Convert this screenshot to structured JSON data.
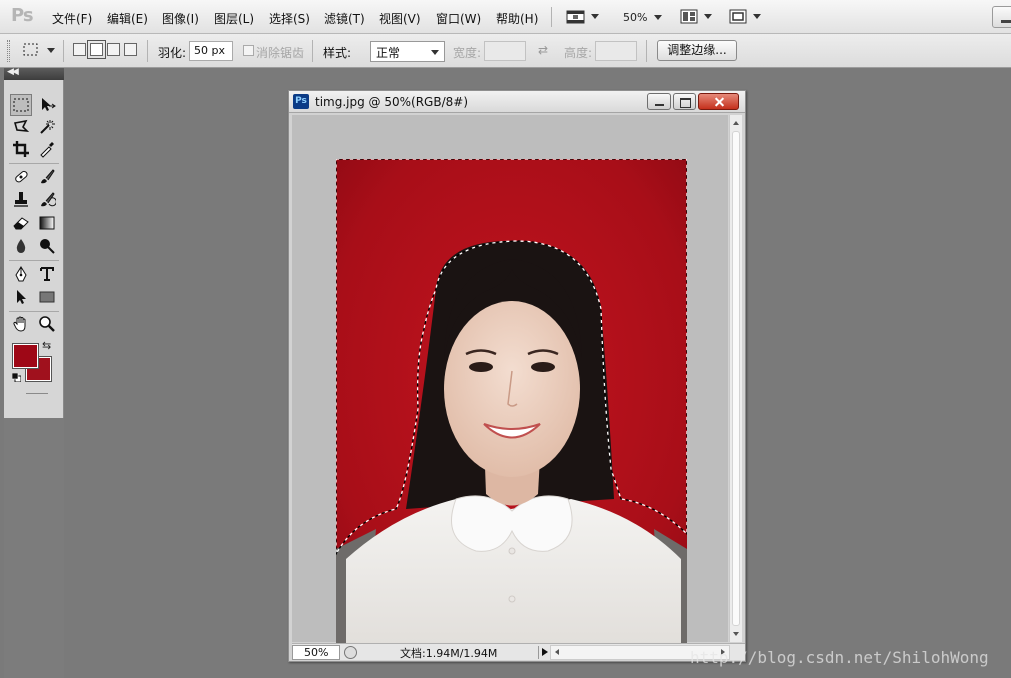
{
  "app": {
    "logo": "Ps",
    "menu": [
      "文件(F)",
      "编辑(E)",
      "图像(I)",
      "图层(L)",
      "选择(S)",
      "滤镜(T)",
      "视图(V)",
      "窗口(W)",
      "帮助(H)"
    ],
    "zoom": "50%"
  },
  "options": {
    "feather_label": "羽化:",
    "feather_value": "50 px",
    "antialias_label": "消除锯齿",
    "style_label": "样式:",
    "style_value": "正常",
    "width_label": "宽度:",
    "height_label": "高度:",
    "refine_edge": "调整边缘..."
  },
  "tools": {
    "foreground_color": "#9e0716",
    "background_color": "#a0111d"
  },
  "document": {
    "title": "timg.jpg @ 50%(RGB/8#)",
    "zoom": "50%",
    "doc_info": "文档:1.94M/1.94M"
  },
  "watermark": "http://blog.csdn.net/ShilohWong"
}
